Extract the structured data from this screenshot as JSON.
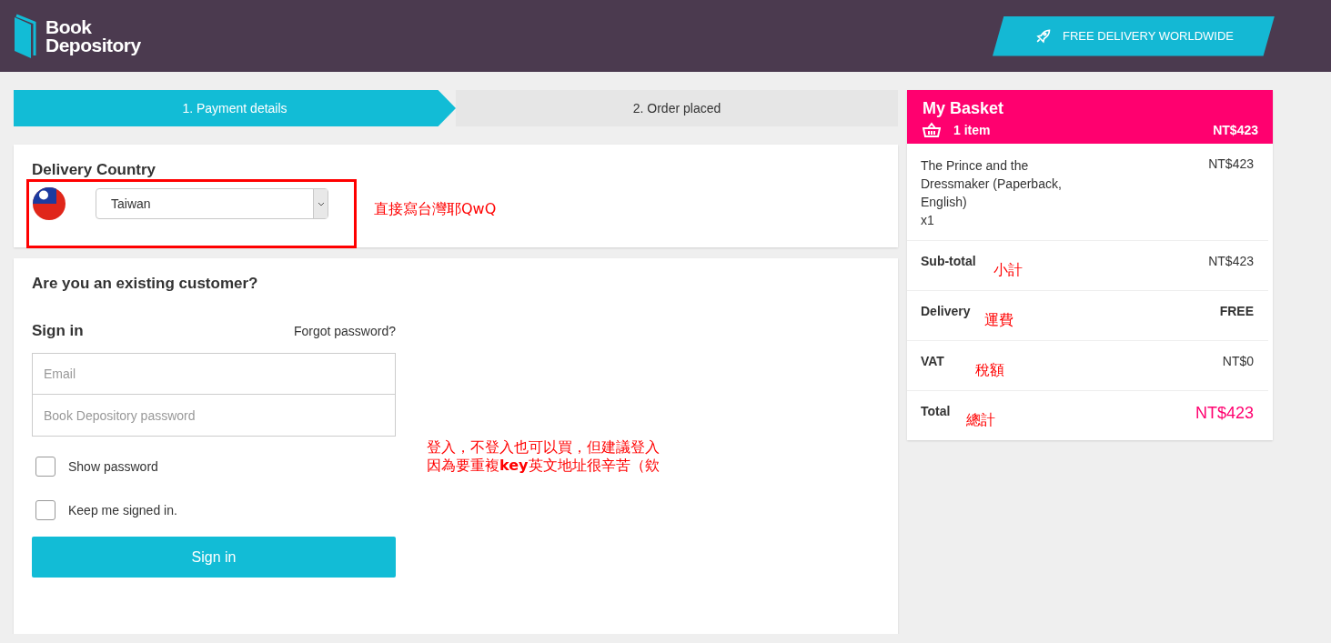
{
  "header": {
    "logo": [
      "Book",
      "Depository"
    ],
    "banner": "FREE DELIVERY WORLDWIDE"
  },
  "steps": [
    {
      "label": "1. Payment details",
      "selected": true
    },
    {
      "label": "2. Order placed",
      "selected": false
    }
  ],
  "delivery": {
    "title": "Delivery Country",
    "country": "Taiwan",
    "note": "直接寫台灣耶QwQ"
  },
  "signin": {
    "question": "Are you an existing customer?",
    "title": "Sign in",
    "forgot": "Forgot password?",
    "email_placeholder": "Email",
    "password_placeholder": "Book Depository password",
    "options": [
      {
        "label": "Show password",
        "checked": false
      },
      {
        "label": "Keep me signed in.",
        "checked": false
      }
    ],
    "button": "Sign in",
    "note": [
      "登入，不登入也可以買，但建議登入",
      "因為要重複**key**英文地址很辛苦（欸"
    ]
  },
  "basket": {
    "title": "My Basket",
    "count": "1 item",
    "total_header": "NT$423",
    "items": [
      {
        "name": "The Prince and the Dressmaker (Paperback, English)",
        "qty": "x1",
        "price": "NT$423"
      }
    ],
    "summary": [
      {
        "label": "Sub-total",
        "note": "小計",
        "value": "NT$423",
        "kind": "plain"
      },
      {
        "label": "Delivery",
        "note": "運費",
        "value": "FREE",
        "kind": "bold"
      },
      {
        "label": "VAT",
        "note": "稅額",
        "value": "NT$0",
        "kind": "plain"
      },
      {
        "label": "Total",
        "note": "總計",
        "value": "NT$423",
        "kind": "total"
      }
    ]
  }
}
